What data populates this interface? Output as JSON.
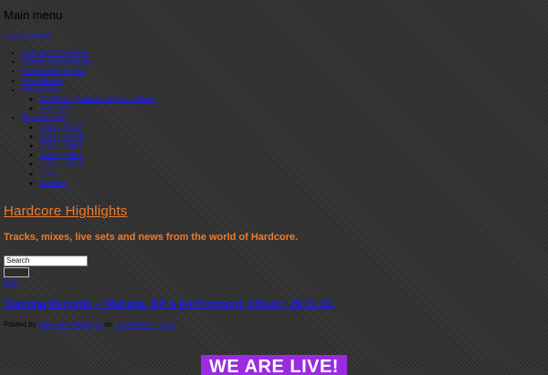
{
  "header": {
    "menu_heading": "Main menu",
    "skip_link": "Skip to content"
  },
  "nav": {
    "items": [
      {
        "label": "Australia With Force"
      },
      {
        "label": "Donate Our Hardcore"
      },
      {
        "label": "Freeform Endorsed"
      },
      {
        "label": "Free Albums"
      },
      {
        "label": "Mix Archive",
        "children": [
          {
            "label": "DJ Mixes, Podcasts & Radio Shows"
          },
          {
            "label": "Live Sets"
          }
        ]
      },
      {
        "label": "Track Archive",
        "children": [
          {
            "label": "2011 – Part I"
          },
          {
            "label": "2011 – Part II"
          },
          {
            "label": "2012 – Part I"
          },
          {
            "label": "2013 – Part I"
          },
          {
            "label": "2013 – Part II"
          },
          {
            "label": "2014"
          },
          {
            "label": "Bundles"
          }
        ]
      }
    ]
  },
  "site": {
    "title": "Hardcore Highlights",
    "tagline": "Tracks, mixes, live sets and news from the world of Hardcore.",
    "accent_color": "#f07a2b",
    "link_color": "#1a1aee"
  },
  "search": {
    "value": "Search",
    "submit_label": ""
  },
  "rss": {
    "label": "RSS"
  },
  "post": {
    "title": "Stamina Records – Website, EP & Forthcoming Album | 29.11.13.",
    "meta_prefix": "Posted by",
    "author": "Hardcore Highlights",
    "meta_on": "on",
    "date": "December 1, 2013"
  },
  "banner": {
    "text": "WE ARE LIVE!",
    "color": "#9a2be0"
  }
}
